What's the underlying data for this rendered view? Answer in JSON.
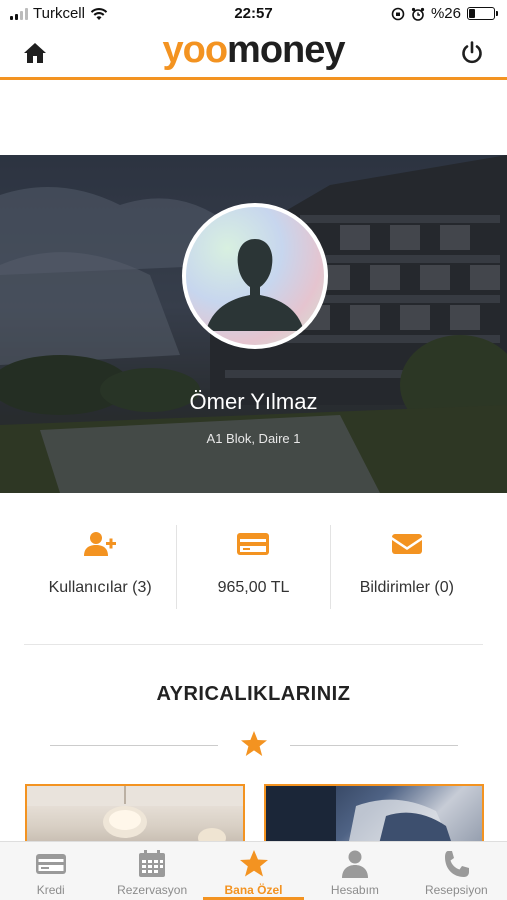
{
  "status_bar": {
    "carrier": "Turkcell",
    "time": "22:57",
    "battery": "%26",
    "battery_level": 0.26
  },
  "header": {
    "logo_yoo": "yoo",
    "logo_money": "money"
  },
  "profile": {
    "name": "Ömer Yılmaz",
    "address": "A1 Blok, Daire 1"
  },
  "stats": [
    {
      "label": "Kullanıcılar (3)",
      "icon": "add-user-icon"
    },
    {
      "label": "965,00 TL",
      "icon": "credit-card-icon"
    },
    {
      "label": "Bildirimler (0)",
      "icon": "envelope-icon"
    }
  ],
  "section": {
    "title": "AYRICALIKLARINIZ",
    "icon": "star-icon"
  },
  "tabbar": {
    "active": "Bana Özel",
    "items": [
      {
        "label": "Kredi",
        "icon": "card-icon"
      },
      {
        "label": "Rezervasyon",
        "icon": "calendar-icon"
      },
      {
        "label": "Bana Özel",
        "icon": "star-icon"
      },
      {
        "label": "Hesabım",
        "icon": "person-icon"
      },
      {
        "label": "Resepsiyon",
        "icon": "phone-icon"
      }
    ]
  },
  "colors": {
    "accent": "#f39321",
    "text": "#2f2f2f",
    "tab_inactive": "#8c8c8c"
  }
}
